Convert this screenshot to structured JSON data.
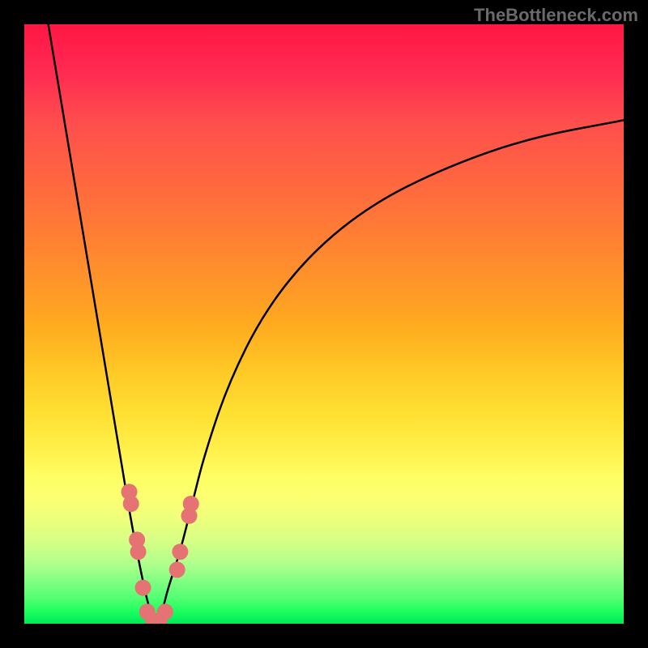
{
  "watermark": "TheBottleneck.com",
  "chart_data": {
    "type": "line",
    "title": "",
    "xlabel": "",
    "ylabel": "",
    "x_range": [
      0,
      100
    ],
    "y_range": [
      0,
      100
    ],
    "minimum_x": 22,
    "series": [
      {
        "name": "curve",
        "color": "#000000",
        "x": [
          4,
          6,
          8,
          10,
          12,
          14,
          16,
          18,
          20,
          21,
          22,
          23,
          24,
          26,
          28,
          30,
          34,
          40,
          48,
          58,
          70,
          84,
          100
        ],
        "y": [
          100,
          88,
          76,
          64,
          52,
          40,
          28,
          16,
          6,
          2,
          0,
          2,
          6,
          12,
          20,
          28,
          40,
          52,
          62,
          70,
          76,
          81,
          84
        ]
      }
    ],
    "markers": {
      "color": "#e57373",
      "radius": 10,
      "points": [
        {
          "x": 17.5,
          "y": 22
        },
        {
          "x": 17.8,
          "y": 20
        },
        {
          "x": 18.8,
          "y": 14
        },
        {
          "x": 19.0,
          "y": 12
        },
        {
          "x": 19.8,
          "y": 6
        },
        {
          "x": 20.5,
          "y": 2
        },
        {
          "x": 21.5,
          "y": 0.5
        },
        {
          "x": 22.5,
          "y": 0.5
        },
        {
          "x": 23.5,
          "y": 2
        },
        {
          "x": 25.5,
          "y": 9
        },
        {
          "x": 26.0,
          "y": 12
        },
        {
          "x": 27.5,
          "y": 18
        },
        {
          "x": 27.8,
          "y": 20
        }
      ]
    }
  }
}
